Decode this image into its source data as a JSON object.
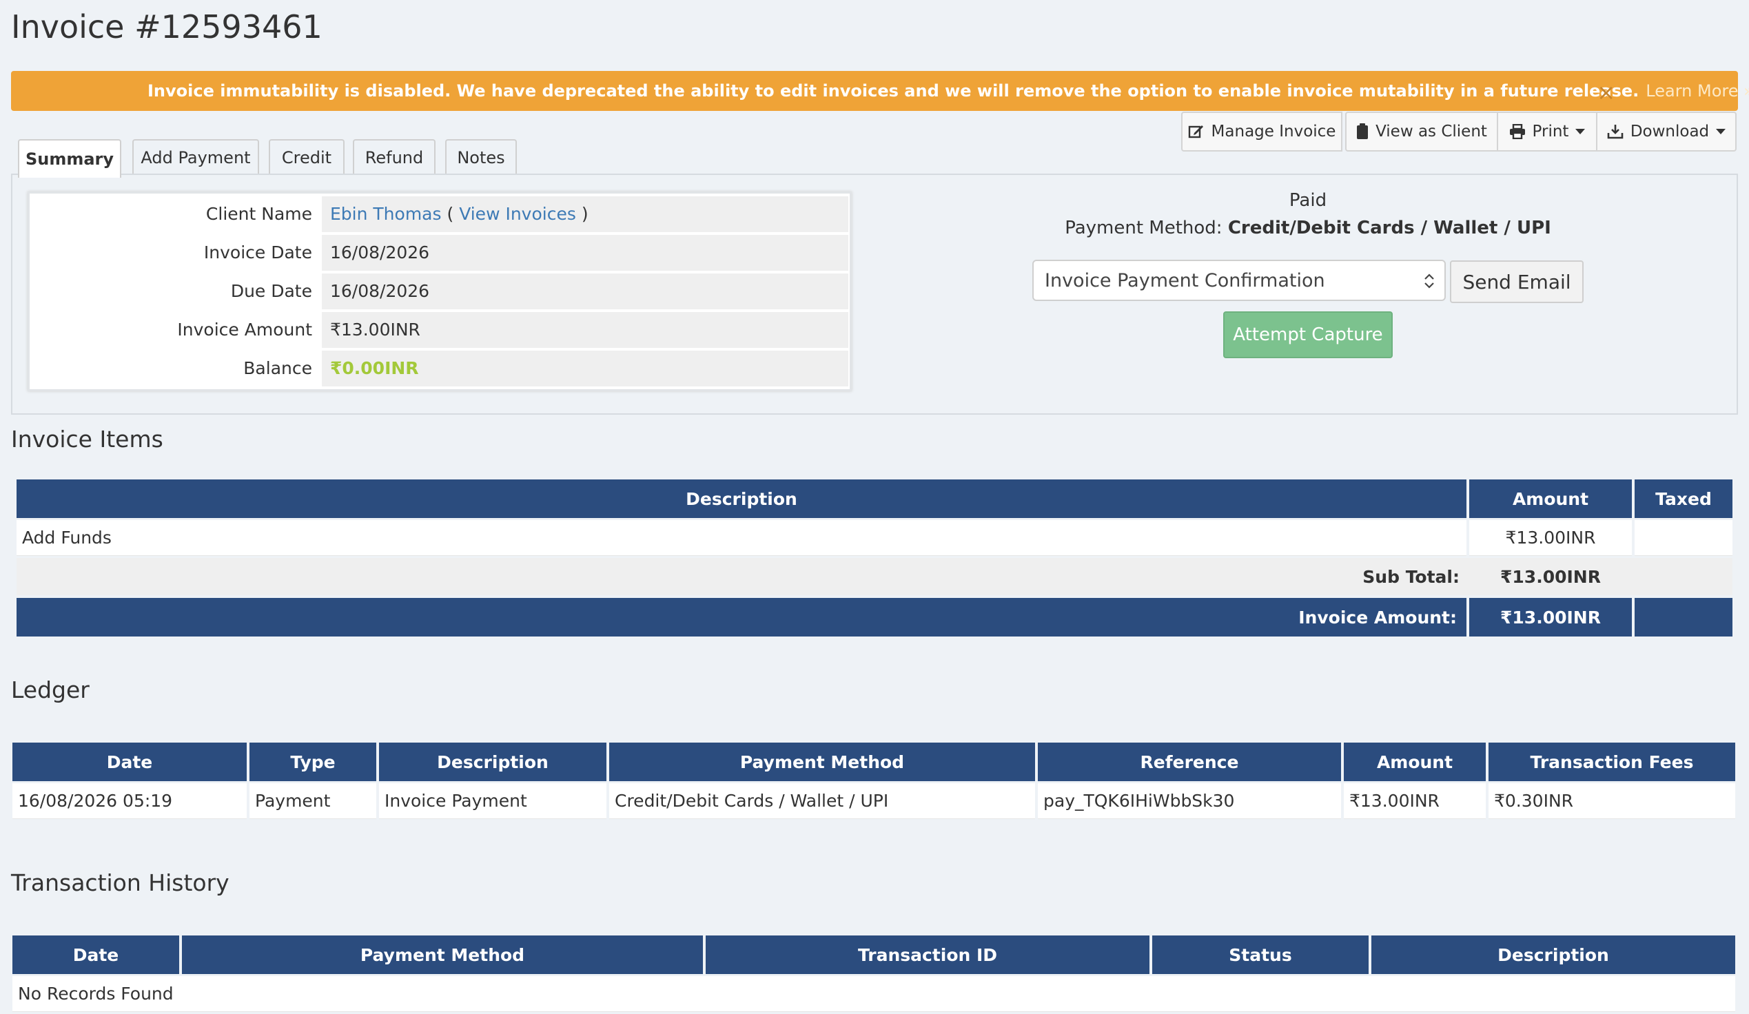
{
  "header": {
    "title": "Invoice #12593461"
  },
  "alert": {
    "message": "Invoice immutability is disabled. We have deprecated the ability to edit invoices and we will remove the option to enable invoice mutability in a future release.",
    "link": "Learn More »",
    "close": "×",
    "color": "#efa337"
  },
  "actions": {
    "manage": "Manage Invoice",
    "view_client": "View as Client",
    "print": "Print",
    "download": "Download"
  },
  "tabs": [
    {
      "label": "Summary"
    },
    {
      "label": "Add Payment"
    },
    {
      "label": "Credit"
    },
    {
      "label": "Refund"
    },
    {
      "label": "Notes"
    }
  ],
  "summary": {
    "client_label": "Client Name",
    "client_name": "Ebin Thomas",
    "paren_open": "(",
    "view_invoices": "View Invoices",
    "paren_close": ")",
    "date_label": "Invoice Date",
    "date": "16/08/2026",
    "due_label": "Due Date",
    "due": "16/08/2026",
    "amount_label": "Invoice Amount",
    "amount": "₹13.00INR",
    "balance_label": "Balance",
    "balance": "₹0.00INR"
  },
  "status": {
    "state": "Paid",
    "method_label": "Payment Method:",
    "method": "Credit/Debit Cards / Wallet / UPI",
    "email_select": "Invoice Payment Confirmation",
    "send_email": "Send Email",
    "attempt_capture": "Attempt Capture"
  },
  "items": {
    "title": "Invoice Items",
    "headers": {
      "description": "Description",
      "amount": "Amount",
      "taxed": "Taxed"
    },
    "rows": [
      {
        "description": "Add Funds",
        "amount": "₹13.00INR",
        "taxed": ""
      }
    ],
    "subtotal_label": "Sub Total:",
    "subtotal": "₹13.00INR",
    "total_label": "Invoice Amount:",
    "total": "₹13.00INR"
  },
  "ledger": {
    "title": "Ledger",
    "headers": [
      "Date",
      "Type",
      "Description",
      "Payment Method",
      "Reference",
      "Amount",
      "Transaction Fees"
    ],
    "rows": [
      [
        "16/08/2026 05:19",
        "Payment",
        "Invoice Payment",
        "Credit/Debit Cards / Wallet / UPI",
        "pay_TQK6IHiWbbSk30",
        "₹13.00INR",
        "₹0.30INR"
      ]
    ]
  },
  "history": {
    "title": "Transaction History",
    "headers": [
      "Date",
      "Payment Method",
      "Transaction ID",
      "Status",
      "Description"
    ],
    "empty": "No Records Found"
  },
  "colors": {
    "table_header": "#2b4c7e",
    "link": "#3d7ab5",
    "balance": "#a3c93a",
    "capture_button": "#7cc28e"
  }
}
